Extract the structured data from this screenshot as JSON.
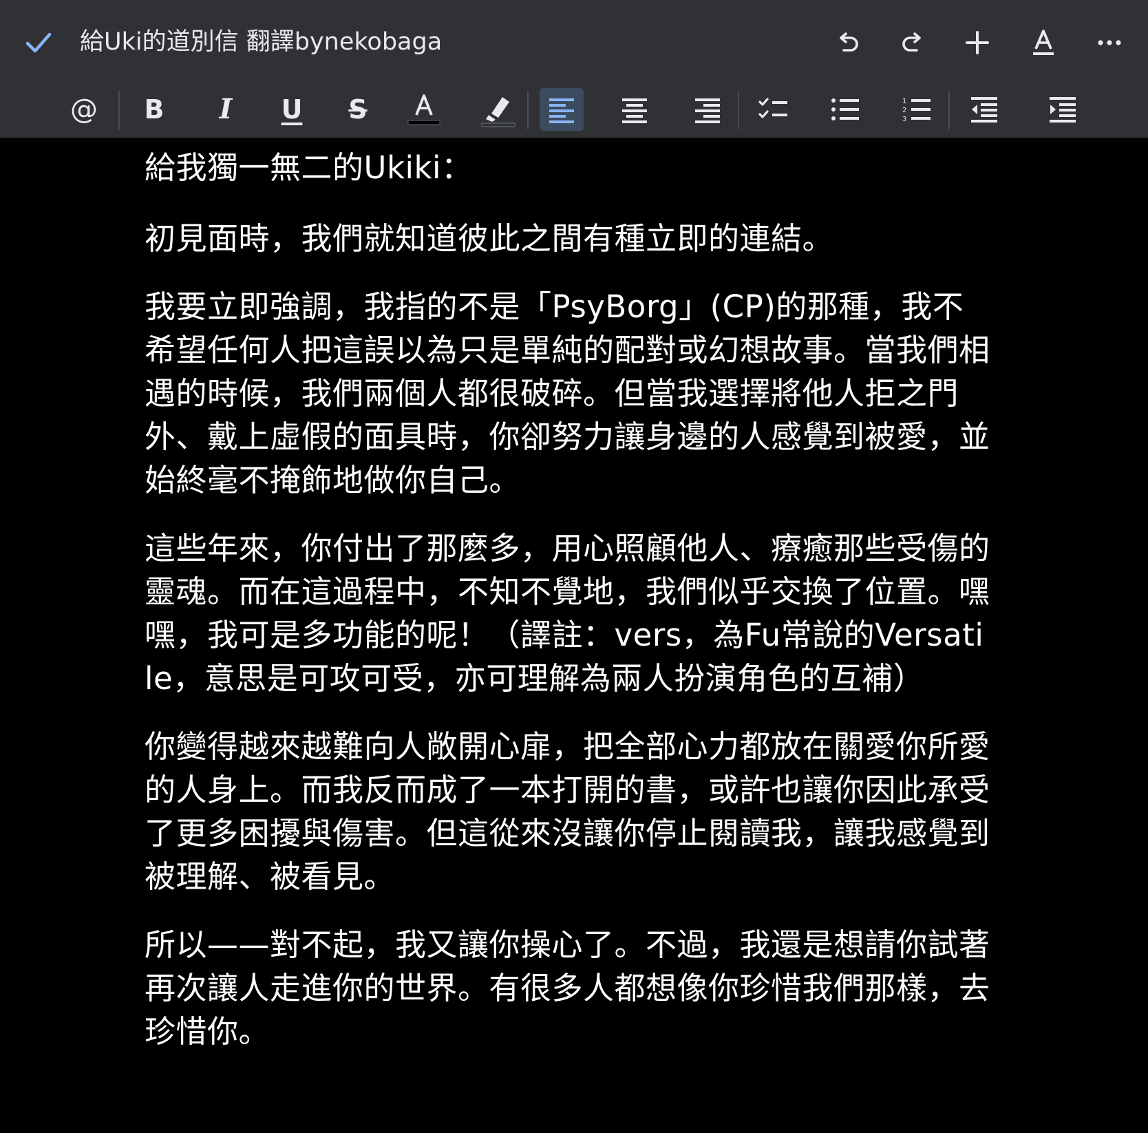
{
  "app": {
    "title": "給Uki的道別信 翻譯bynekobaga"
  },
  "colors": {
    "toolbar_bg": "#303134",
    "document_bg": "#000000",
    "text": "#ffffff",
    "accent_blue": "#8ab4f8",
    "active_button_bg": "#3c4b5e"
  },
  "top_actions": [
    {
      "name": "done-check-icon"
    },
    {
      "name": "undo-icon"
    },
    {
      "name": "redo-icon"
    },
    {
      "name": "insert-plus-icon"
    },
    {
      "name": "text-format-icon"
    },
    {
      "name": "more-options-icon"
    }
  ],
  "toolbar": {
    "mention": "@",
    "bold": "B",
    "italic": "I",
    "underline": "U",
    "strikethrough": "S",
    "text_color": "A",
    "active_alignment": "align-left"
  },
  "document": {
    "paragraphs": [
      "給我獨一無二的Ukiki：",
      "初見面時，我們就知道彼此之間有種立即的連結。",
      "我要立即強調，我指的不是「PsyBorg」(CP)的那種，我不希望任何人把這誤以為只是單純的配對或幻想故事。當我們相遇的時候，我們兩個人都很破碎。但當我選擇將他人拒之門外、戴上虛假的面具時，你卻努力讓身邊的人感覺到被愛，並始終毫不掩飾地做你自己。",
      "這些年來，你付出了那麼多，用心照顧他人、療癒那些受傷的靈魂。而在這過程中，不知不覺地，我們似乎交換了位置。嘿嘿，我可是多功能的呢！（譯註：vers，為Fu常說的Versatile，意思是可攻可受，亦可理解為兩人扮演角色的互補）",
      "你變得越來越難向人敞開心扉，把全部心力都放在關愛你所愛的人身上。而我反而成了一本打開的書，或許也讓你因此承受了更多困擾與傷害。但這從來沒讓你停止閱讀我，讓我感覺到被理解、被看見。",
      "所以——對不起，我又讓你操心了。不過，我還是想請你試著再次讓人走進你的世界。有很多人都想像你珍惜我們那樣，去珍惜你。"
    ]
  }
}
